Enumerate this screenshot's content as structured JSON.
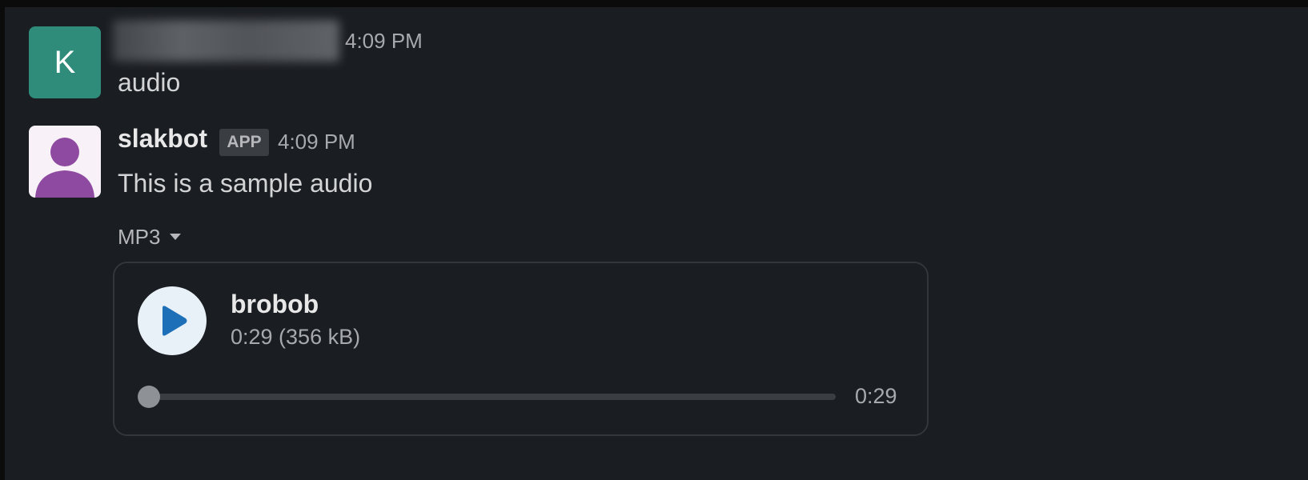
{
  "messages": [
    {
      "avatar_letter": "K",
      "avatar_color": "#2f8c7a",
      "time": "4:09 PM",
      "text": "audio"
    },
    {
      "sender": "slakbot",
      "badge": "APP",
      "time": "4:09 PM",
      "text": "This is a sample audio",
      "avatar_icon": "user-silhouette-icon",
      "avatar_color": "#8e4aa0",
      "attachment": {
        "format_label": "MP3",
        "format_icon": "caret-down-icon",
        "file_name": "brobob",
        "meta": "0:29 (356 kB)",
        "duration": "0:29",
        "progress": 0,
        "play_icon": "play-icon",
        "accent": "#1d6fb8"
      }
    }
  ]
}
